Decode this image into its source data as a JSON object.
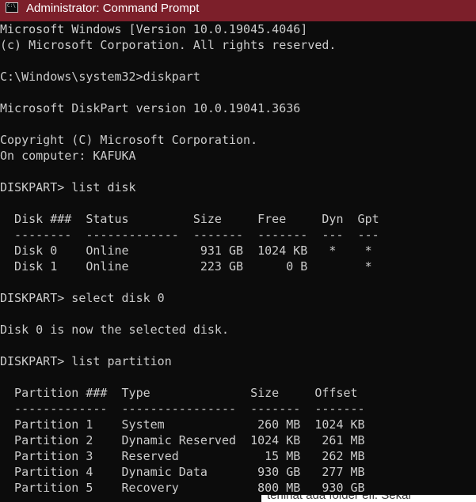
{
  "window": {
    "title": "Administrator: Command Prompt",
    "icon": "cmd-icon",
    "icon_glyph": "C:\\",
    "titlebar_color": "#7c1f2a",
    "console_bg": "#0c0c0c",
    "console_fg": "#cccccc"
  },
  "console": {
    "lines": [
      "Microsoft Windows [Version 10.0.19045.4046]",
      "(c) Microsoft Corporation. All rights reserved.",
      "",
      "C:\\Windows\\system32>diskpart",
      "",
      "Microsoft DiskPart version 10.0.19041.3636",
      "",
      "Copyright (C) Microsoft Corporation.",
      "On computer: KAFUKA",
      "",
      "DISKPART> list disk",
      "",
      "  Disk ###  Status         Size     Free     Dyn  Gpt",
      "  --------  -------------  -------  -------  ---  ---",
      "  Disk 0    Online          931 GB  1024 KB   *    *",
      "  Disk 1    Online          223 GB      0 B        *",
      "",
      "DISKPART> select disk 0",
      "",
      "Disk 0 is now the selected disk.",
      "",
      "DISKPART> list partition",
      "",
      "  Partition ###  Type              Size     Offset",
      "  -------------  ----------------  -------  -------",
      "  Partition 1    System             260 MB  1024 KB",
      "  Partition 2    Dynamic Reserved  1024 KB   261 MB",
      "  Partition 3    Reserved            15 MB   262 MB",
      "  Partition 4    Dynamic Data       930 GB   277 MB",
      "  Partition 5    Recovery           800 MB   930 GB"
    ]
  },
  "background_page": {
    "partial_text": "terlihat ada folder efi. Sekar"
  }
}
